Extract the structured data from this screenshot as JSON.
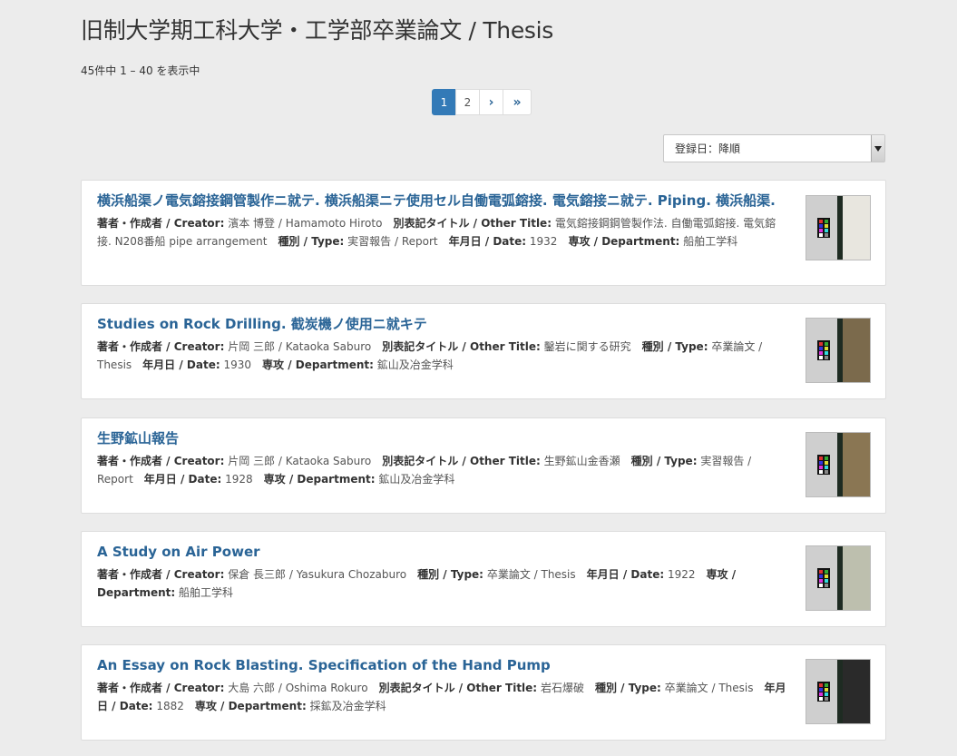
{
  "page": {
    "title": "旧制大学期工科大学・工学部卒業論文 / Thesis",
    "count": "45件中 1 – 40 を表示中"
  },
  "pagination": [
    "1",
    "2",
    "›",
    "»"
  ],
  "sort": {
    "label": "登録日：降順"
  },
  "labels": {
    "creator": "著者・作成者 / Creator:",
    "other_title": "別表記タイトル / Other Title:",
    "type": "種別 / Type:",
    "date": "年月日 / Date:",
    "department": "専攻 / Department:"
  },
  "items": [
    {
      "title": "横浜船渠ノ電気鎔接鋼管製作ニ就テ. 横浜船渠ニテ使用セル自働電弧鎔接. 電気鎔接ニ就テ. Piping. 横浜船渠.",
      "creator": "濱本 博登 / Hamamoto Hiroto",
      "other_title": "電気鎔接鋼鋼管製作法. 自働電弧鎔接. 電気鎔接. N208番船 pipe arrangement",
      "type": "実習報告 / Report",
      "date": "1932",
      "department": "船舶工学科"
    },
    {
      "title": "Studies on Rock Drilling. 截炭機ノ使用ニ就キテ",
      "creator": "片岡 三郎 / Kataoka Saburo",
      "other_title": "鑿岩に関する研究",
      "type": "卒業論文 / Thesis",
      "date": "1930",
      "department": "鉱山及冶金学科"
    },
    {
      "title": "生野鉱山報告",
      "creator": "片岡 三郎 / Kataoka Saburo",
      "other_title": "生野鉱山金香瀬",
      "type": "実習報告 / Report",
      "date": "1928",
      "department": "鉱山及冶金学科"
    },
    {
      "title": "A Study on Air Power",
      "creator": "保倉 長三郎 / Yasukura Chozaburo",
      "type": "卒業論文 / Thesis",
      "date": "1922",
      "department": "船舶工学科"
    },
    {
      "title": "An Essay on Rock Blasting. Specification of the Hand Pump",
      "creator": "大島 六郎 / Oshima Rokuro",
      "other_title": "岩石爆破",
      "type": "卒業論文 / Thesis",
      "date": "1882",
      "department": "採鉱及冶金学科"
    }
  ],
  "thumb_covers": [
    "#e8e6df",
    "#7b6a4c",
    "#8a7653",
    "#bdbfae",
    "#2a2a2a"
  ]
}
